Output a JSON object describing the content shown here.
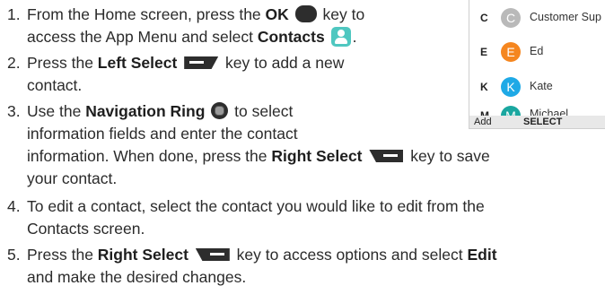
{
  "steps": [
    {
      "num": "1.",
      "l1a": "From the Home screen, press the ",
      "l1b": "OK",
      "l1c": " key to",
      "l2a": "access the App Menu and select ",
      "l2b": "Contacts",
      "l2c": "."
    },
    {
      "num": "2.",
      "l1a": "Press the ",
      "l1b": "Left Select",
      "l1c": " key to add a new",
      "l2": "contact."
    },
    {
      "num": "3.",
      "l1a": "Use the ",
      "l1b": "Navigation Ring",
      "l1c": " to select",
      "l2": "information fields and enter the contact",
      "l3a": "information. When done, press the ",
      "l3b": "Right Select",
      "l3c": " key to save",
      "l4": "your contact."
    },
    {
      "num": "4.",
      "l1": "To edit a contact, select the contact you would like to edit from the",
      "l2": "Contacts screen."
    },
    {
      "num": "5.",
      "l1a": "Press the ",
      "l1b": "Right Select",
      "l1c": " key to access options and select ",
      "l1d": "Edit",
      "l2": "and make the desired changes."
    }
  ],
  "phone": {
    "contacts": [
      {
        "letter": "C",
        "initial": "C",
        "name": "Customer Sup",
        "color": "#b9b9b9"
      },
      {
        "letter": "E",
        "initial": "E",
        "name": "Ed",
        "color": "#f5861f"
      },
      {
        "letter": "K",
        "initial": "K",
        "name": "Kate",
        "color": "#1ea9e6"
      },
      {
        "letter": "M",
        "initial": "M",
        "name": "Michael",
        "color": "#1aa7a0"
      }
    ],
    "softkeys": {
      "left": "Add",
      "center": "SELECT"
    }
  }
}
